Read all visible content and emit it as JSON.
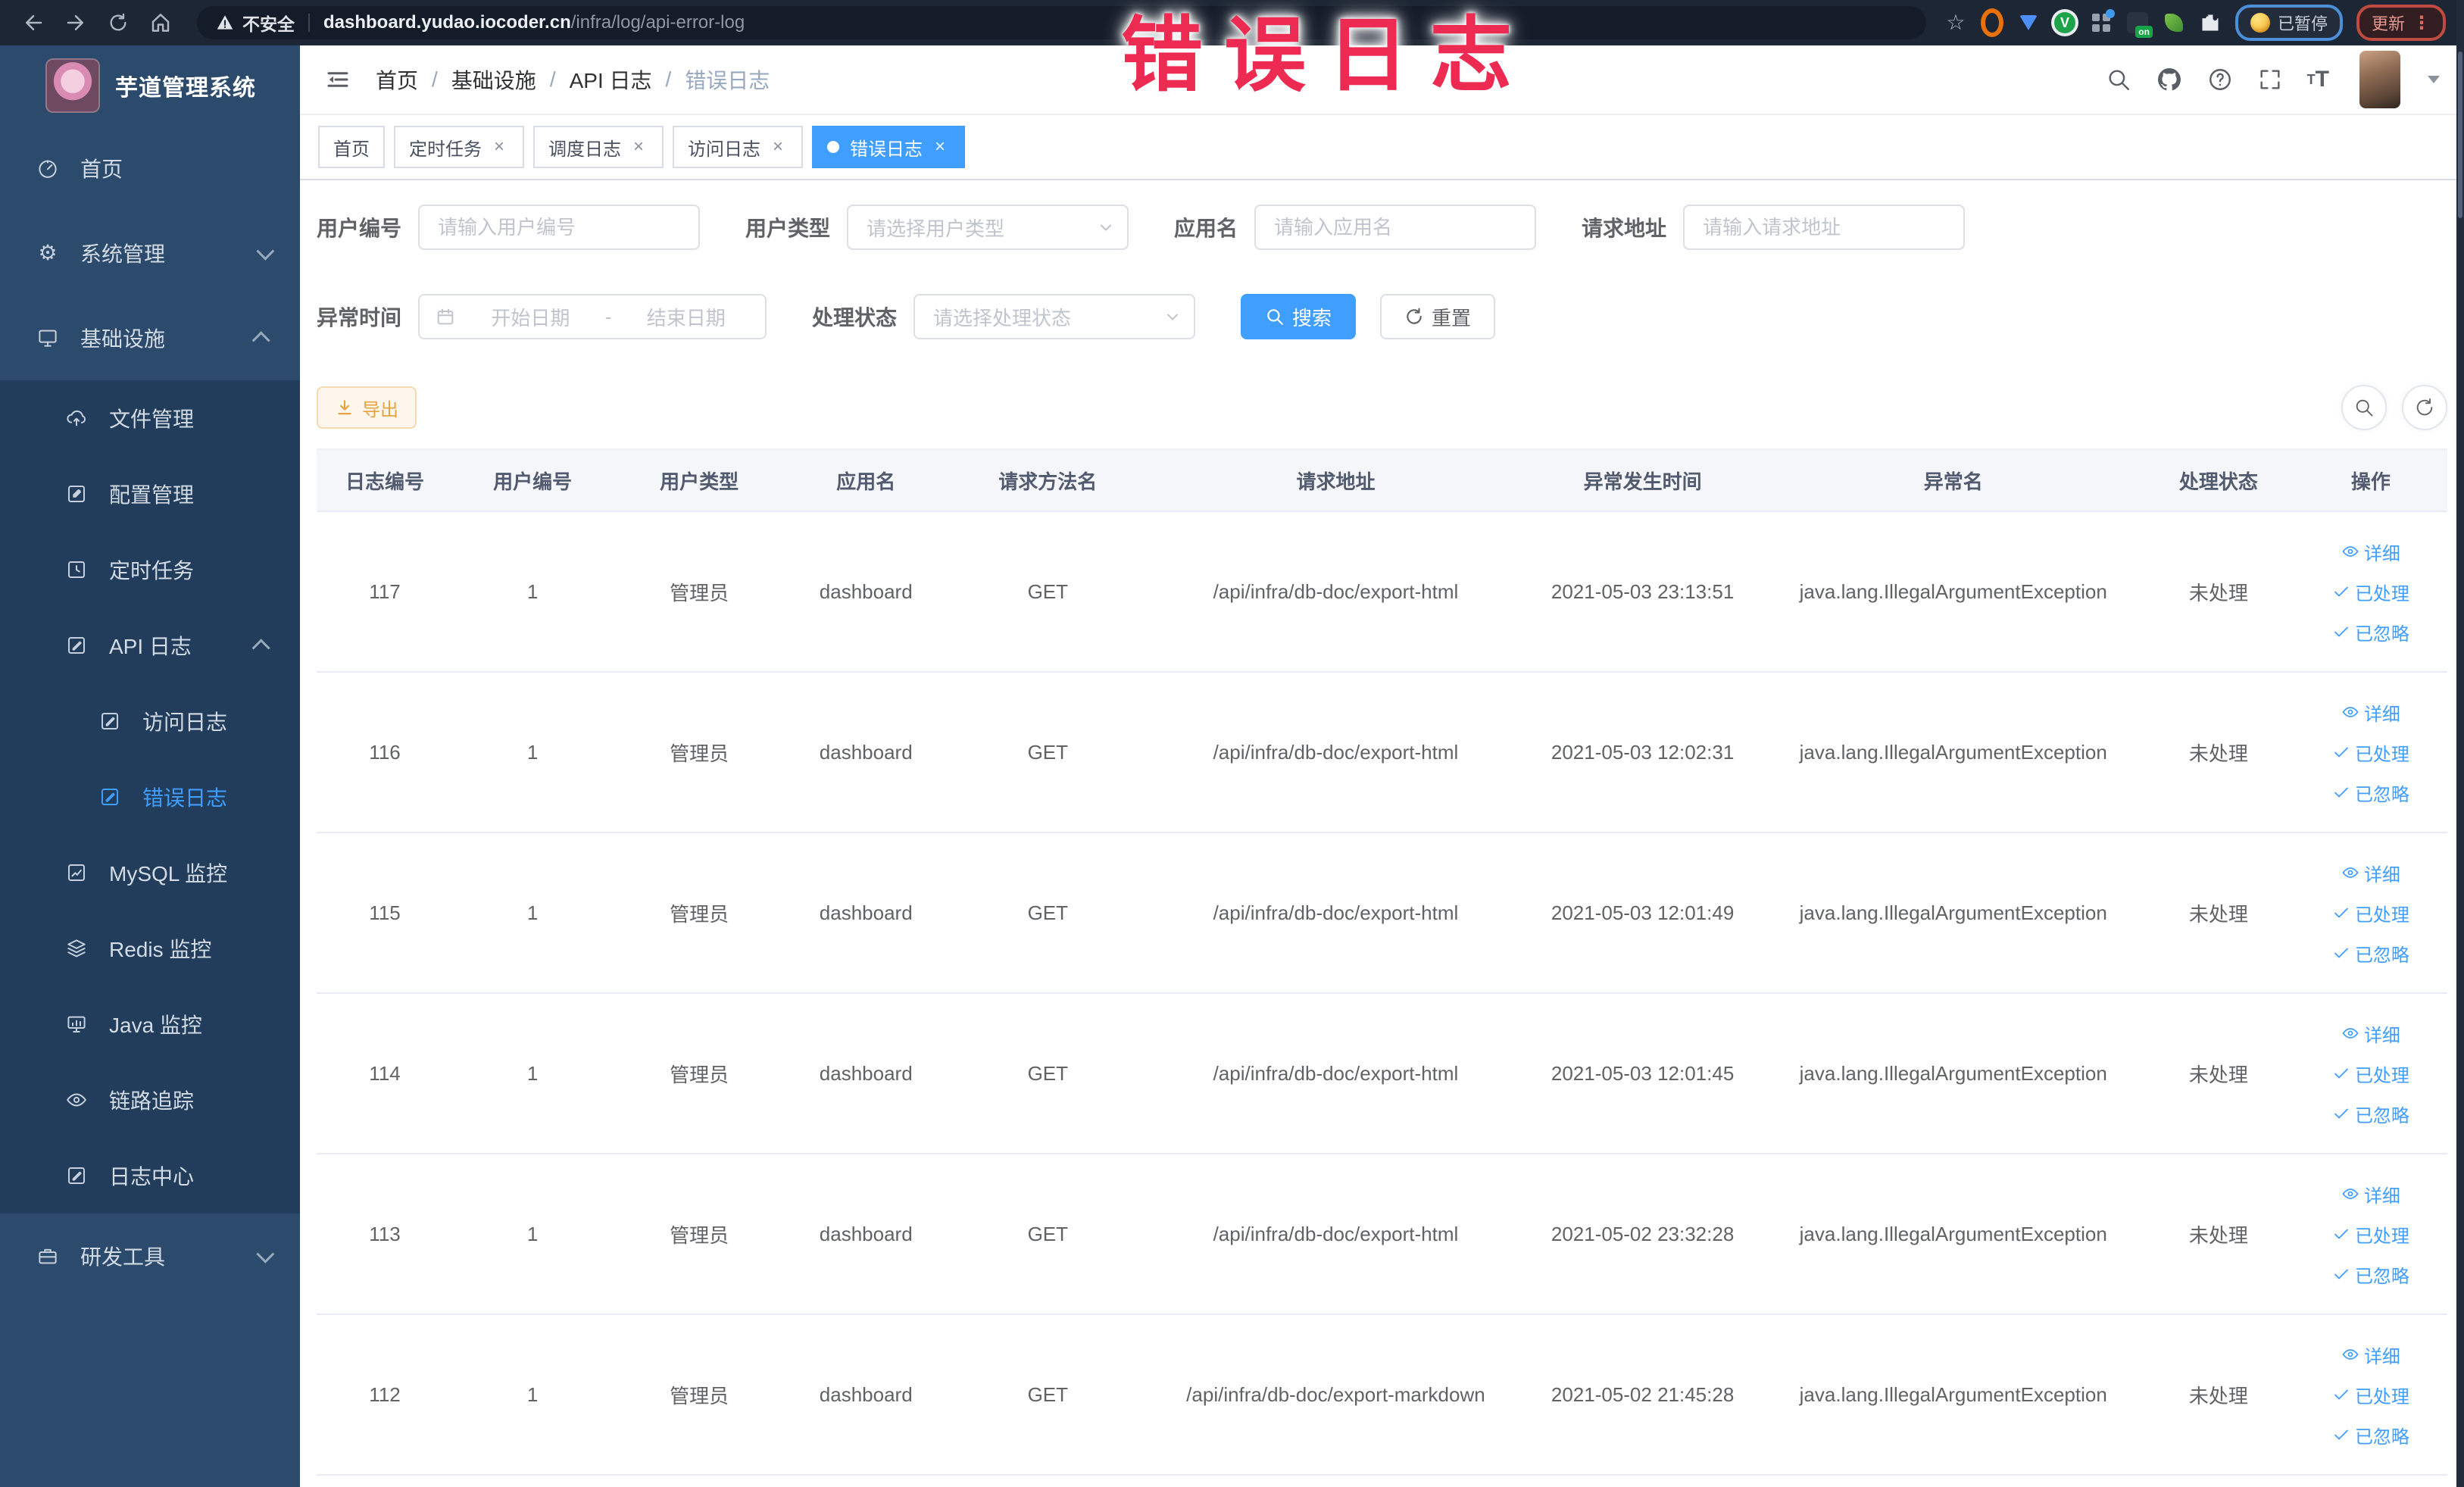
{
  "colors": {
    "accent": "#409eff",
    "warning": "#e6a23c",
    "overlay_red": "#ed2b52",
    "sidebar_bg": "#2c4a6c",
    "submenu_bg": "#223d5c",
    "chrome_bg": "#1d2634"
  },
  "browser": {
    "security_label": "不安全",
    "url_domain": "dashboard.yudao.iocoder.cn",
    "url_path": "/infra/log/api-error-log",
    "ext_on_badge": "on",
    "paused_pill_label": "已暂停",
    "update_pill_label": "更新",
    "menu_dots": "⋮",
    "star_glyph": "☆"
  },
  "overlay": {
    "title": "错误日志"
  },
  "sidebar": {
    "title": "芋道管理系统",
    "home": "首页",
    "system": "系统管理",
    "infra": "基础设施",
    "file": "文件管理",
    "config": "配置管理",
    "job": "定时任务",
    "api_log": "API 日志",
    "access_log": "访问日志",
    "error_log": "错误日志",
    "mysql": "MySQL 监控",
    "redis": "Redis 监控",
    "java": "Java 监控",
    "trace": "链路追踪",
    "log_center": "日志中心",
    "dev_tools": "研发工具",
    "gear_glyph": "⚙"
  },
  "navbar": {
    "breadcrumb": [
      "首页",
      "基础设施",
      "API 日志",
      "错误日志"
    ],
    "separator": "/",
    "fontsize_icon_text": "T"
  },
  "tags_view": {
    "close_glyph": "×",
    "tabs": [
      {
        "label": "首页"
      },
      {
        "label": "定时任务"
      },
      {
        "label": "调度日志"
      },
      {
        "label": "访问日志"
      },
      {
        "label": "错误日志"
      }
    ]
  },
  "filters": {
    "user_id_label": "用户编号",
    "user_id_placeholder": "请输入用户编号",
    "user_type_label": "用户类型",
    "user_type_placeholder": "请选择用户类型",
    "app_name_label": "应用名",
    "app_name_placeholder": "请输入应用名",
    "request_url_label": "请求地址",
    "request_url_placeholder": "请输入请求地址",
    "error_time_label": "异常时间",
    "date_start_placeholder": "开始日期",
    "date_separator": "-",
    "date_end_placeholder": "结束日期",
    "process_status_label": "处理状态",
    "process_status_placeholder": "请选择处理状态",
    "search_label": "搜索",
    "reset_label": "重置"
  },
  "toolbar": {
    "export_label": "导出"
  },
  "table": {
    "headers": [
      "日志编号",
      "用户编号",
      "用户类型",
      "应用名",
      "请求方法名",
      "请求地址",
      "异常发生时间",
      "异常名",
      "处理状态",
      "操作"
    ],
    "rows": [
      {
        "id": "117",
        "user_id": "1",
        "user_type": "管理员",
        "app_name": "dashboard",
        "method": "GET",
        "url": "/api/infra/db-doc/export-html",
        "time": "2021-05-03 23:13:51",
        "exception": "java.lang.IllegalArgumentException",
        "status": "未处理",
        "actions": {
          "detail": "详细",
          "processed": "已处理",
          "ignored": "已忽略"
        }
      },
      {
        "id": "116",
        "user_id": "1",
        "user_type": "管理员",
        "app_name": "dashboard",
        "method": "GET",
        "url": "/api/infra/db-doc/export-html",
        "time": "2021-05-03 12:02:31",
        "exception": "java.lang.IllegalArgumentException",
        "status": "未处理",
        "actions": {
          "detail": "详细",
          "processed": "已处理",
          "ignored": "已忽略"
        }
      },
      {
        "id": "115",
        "user_id": "1",
        "user_type": "管理员",
        "app_name": "dashboard",
        "method": "GET",
        "url": "/api/infra/db-doc/export-html",
        "time": "2021-05-03 12:01:49",
        "exception": "java.lang.IllegalArgumentException",
        "status": "未处理",
        "actions": {
          "detail": "详细",
          "processed": "已处理",
          "ignored": "已忽略"
        }
      },
      {
        "id": "114",
        "user_id": "1",
        "user_type": "管理员",
        "app_name": "dashboard",
        "method": "GET",
        "url": "/api/infra/db-doc/export-html",
        "time": "2021-05-03 12:01:45",
        "exception": "java.lang.IllegalArgumentException",
        "status": "未处理",
        "actions": {
          "detail": "详细",
          "processed": "已处理",
          "ignored": "已忽略"
        }
      },
      {
        "id": "113",
        "user_id": "1",
        "user_type": "管理员",
        "app_name": "dashboard",
        "method": "GET",
        "url": "/api/infra/db-doc/export-html",
        "time": "2021-05-02 23:32:28",
        "exception": "java.lang.IllegalArgumentException",
        "status": "未处理",
        "actions": {
          "detail": "详细",
          "processed": "已处理",
          "ignored": "已忽略"
        }
      },
      {
        "id": "112",
        "user_id": "1",
        "user_type": "管理员",
        "app_name": "dashboard",
        "method": "GET",
        "url": "/api/infra/db-doc/export-markdown",
        "time": "2021-05-02 21:45:28",
        "exception": "java.lang.IllegalArgumentException",
        "status": "未处理",
        "actions": {
          "detail": "详细",
          "processed": "已处理",
          "ignored": "已忽略"
        }
      }
    ]
  }
}
